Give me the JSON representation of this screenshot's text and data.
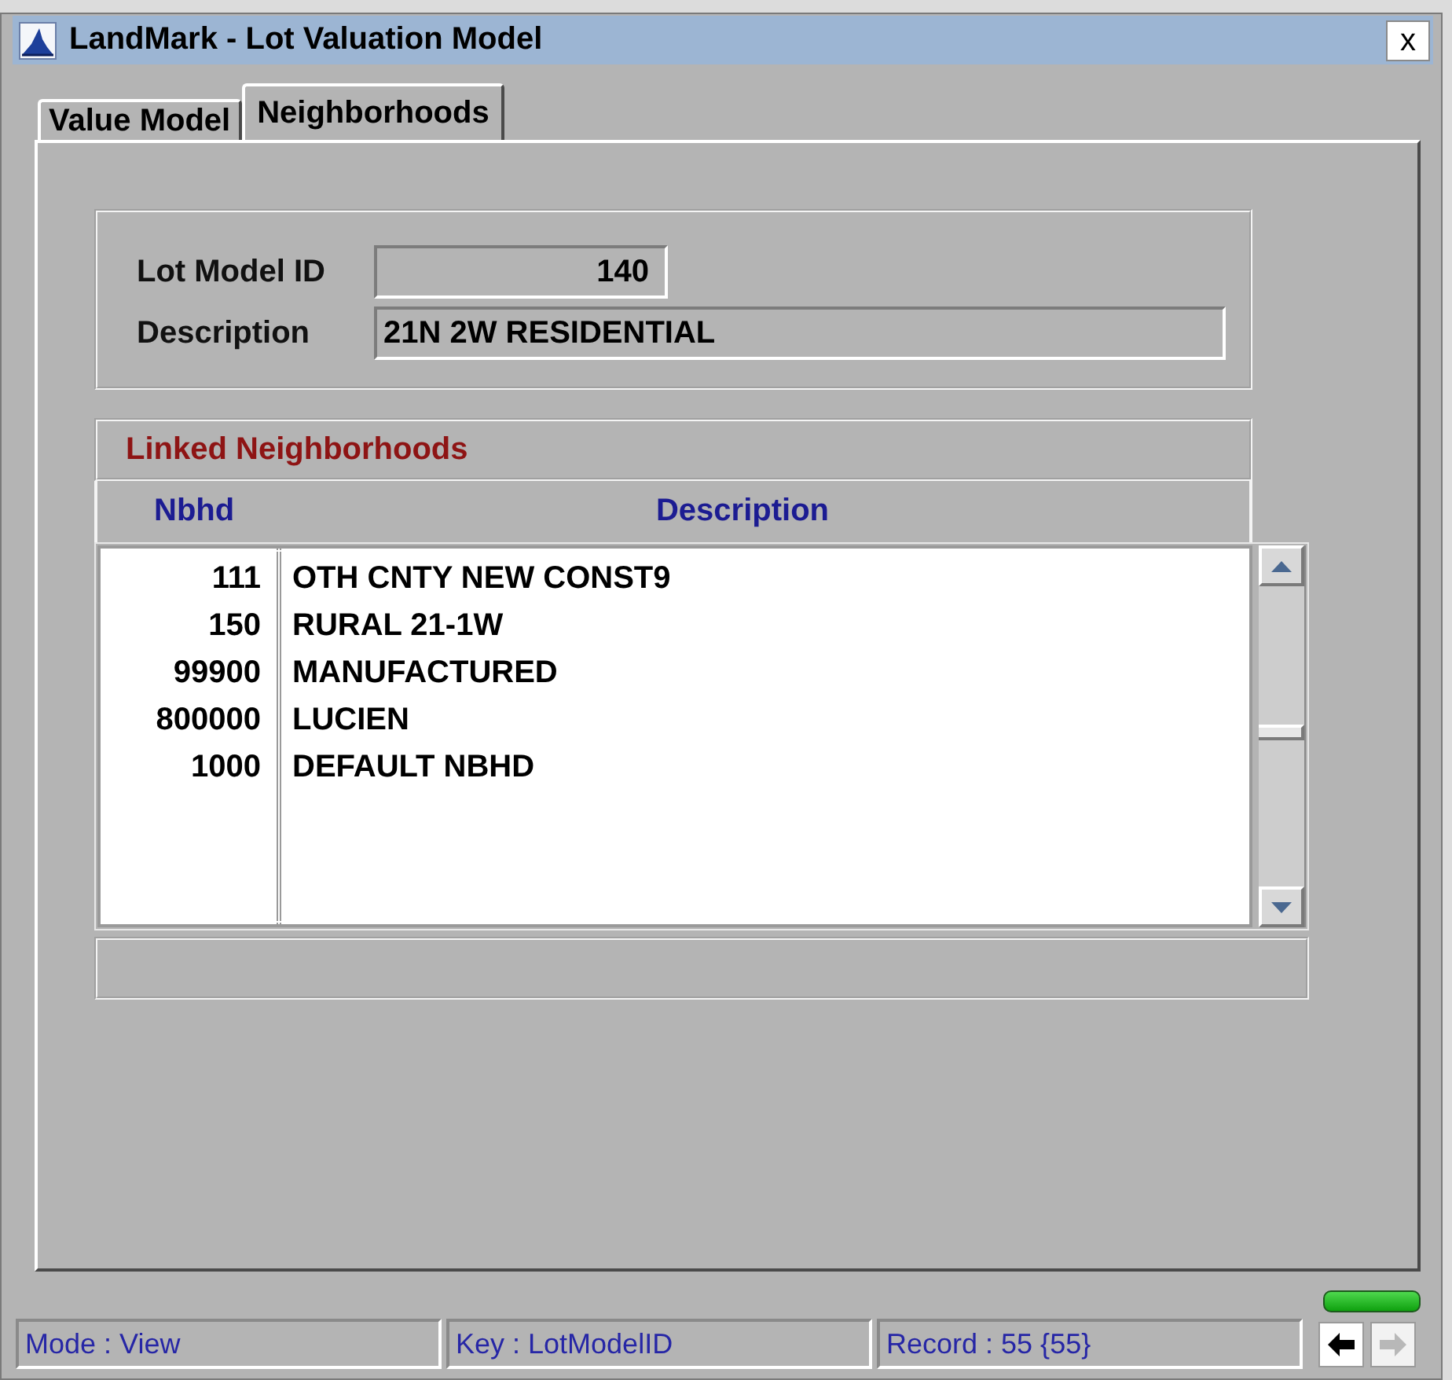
{
  "window": {
    "title": "LandMark - Lot Valuation Model",
    "close_label": "x"
  },
  "tabs": [
    {
      "label": "Value Model",
      "selected": false
    },
    {
      "label": "Neighborhoods",
      "selected": true
    }
  ],
  "lot_model": {
    "fields": [
      {
        "kind": "number",
        "label": "Lot Model ID",
        "value": "140"
      },
      {
        "kind": "text",
        "label": "Description",
        "value": "21N 2W RESIDENTIAL"
      }
    ]
  },
  "linked_neighborhoods": {
    "title": "Linked Neighborhoods",
    "columns": [
      "Nbhd",
      "Description"
    ],
    "rows": [
      {
        "nbhd": "111",
        "description": "OTH CNTY NEW CONST9"
      },
      {
        "nbhd": "150",
        "description": "RURAL 21-1W"
      },
      {
        "nbhd": "99900",
        "description": "MANUFACTURED"
      },
      {
        "nbhd": "800000",
        "description": "LUCIEN"
      },
      {
        "nbhd": "1000",
        "description": "DEFAULT NBHD"
      }
    ]
  },
  "status_light": {
    "on": true
  },
  "status_bar": {
    "panels": [
      "Mode : View",
      "Key : LotModelID",
      "Record : 55 {55}"
    ],
    "nav": [
      {
        "kind": "back",
        "disabled": false
      },
      {
        "kind": "forward",
        "disabled": true
      }
    ]
  }
}
